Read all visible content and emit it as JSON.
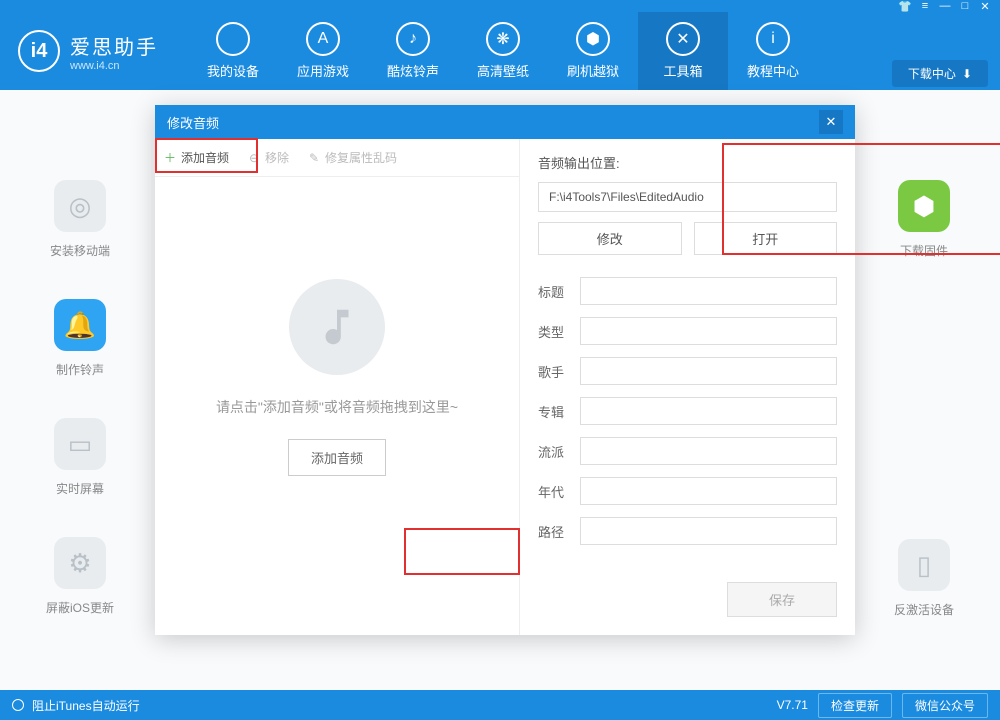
{
  "brand": {
    "cn": "爱思助手",
    "url": "www.i4.cn",
    "logo": "i4"
  },
  "topIcons": [
    "shirt",
    "skin",
    "min",
    "max",
    "close"
  ],
  "nav": [
    {
      "label": "我的设备",
      "icon": ""
    },
    {
      "label": "应用游戏",
      "icon": "A"
    },
    {
      "label": "酷炫铃声",
      "icon": "♪"
    },
    {
      "label": "高清壁纸",
      "icon": "❋"
    },
    {
      "label": "刷机越狱",
      "icon": "⬢"
    },
    {
      "label": "工具箱",
      "icon": "✕",
      "active": true
    },
    {
      "label": "教程中心",
      "icon": "i"
    }
  ],
  "downloadCenter": "下载中心",
  "sideLeft": [
    {
      "label": "安装移动端",
      "color": "gray",
      "icon": "◎"
    },
    {
      "label": "制作铃声",
      "color": "blue",
      "icon": "🔔"
    },
    {
      "label": "实时屏幕",
      "color": "gray",
      "icon": "▭"
    },
    {
      "label": "屏蔽iOS更新",
      "color": "gray",
      "icon": "⚙"
    }
  ],
  "sideRight": [
    {
      "label": "下载固件",
      "color": "green",
      "icon": "⬢"
    },
    {
      "label": "反激活设备",
      "color": "gray",
      "icon": "▯"
    }
  ],
  "dialog": {
    "title": "修改音频",
    "toolbar": {
      "add": "添加音频",
      "remove": "移除",
      "fix": "修复属性乱码"
    },
    "dropHint": "请点击\"添加音频\"或将音频拖拽到这里~",
    "addBtn": "添加音频",
    "output": {
      "label": "音频输出位置:",
      "path": "F:\\i4Tools7\\Files\\EditedAudio",
      "modify": "修改",
      "open": "打开"
    },
    "fields": {
      "title": "标题",
      "type": "类型",
      "artist": "歌手",
      "album": "专辑",
      "genre": "流派",
      "year": "年代",
      "path": "路径"
    },
    "save": "保存"
  },
  "status": {
    "itunes": "阻止iTunes自动运行",
    "version": "V7.71",
    "check": "检查更新",
    "wechat": "微信公众号"
  }
}
